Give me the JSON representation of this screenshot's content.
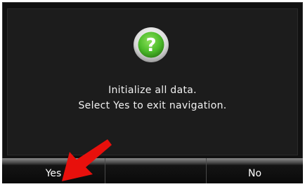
{
  "dialog": {
    "icon": "question-icon",
    "message_line1": "Initialize all data.",
    "message_line2": "Select Yes to exit navigation."
  },
  "buttons": {
    "yes_label": "Yes",
    "middle_label": "",
    "no_label": "No"
  },
  "colors": {
    "background": "#111111",
    "icon_green": "#4cbb2a",
    "arrow_red": "#e8100c",
    "text": "#f2f2f2"
  },
  "annotation": {
    "icon": "red-arrow-pointer"
  }
}
